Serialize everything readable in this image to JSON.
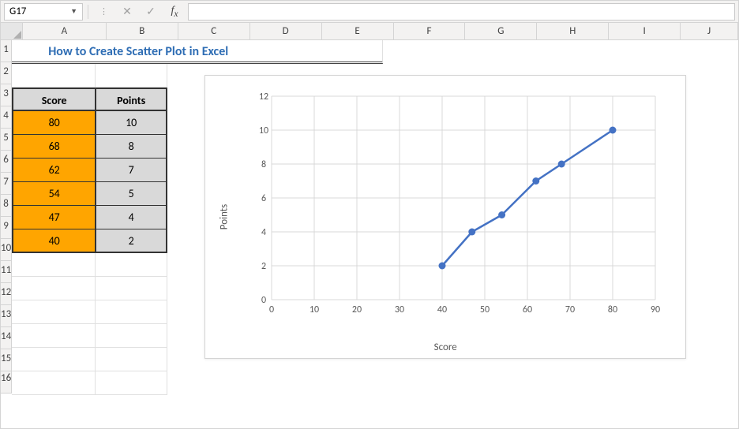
{
  "formula_bar": {
    "name_box": "G17",
    "formula": ""
  },
  "columns": [
    "A",
    "B",
    "C",
    "D",
    "E",
    "F",
    "G",
    "H",
    "I",
    "J"
  ],
  "rows": [
    "1",
    "2",
    "3",
    "4",
    "5",
    "6",
    "7",
    "8",
    "9",
    "10",
    "11",
    "12",
    "13",
    "14",
    "15",
    "16"
  ],
  "title": "How to Create Scatter Plot in Excel",
  "table": {
    "headers": {
      "score": "Score",
      "points": "Points"
    },
    "rows": [
      {
        "score": "80",
        "points": "10"
      },
      {
        "score": "68",
        "points": "8"
      },
      {
        "score": "62",
        "points": "7"
      },
      {
        "score": "54",
        "points": "5"
      },
      {
        "score": "47",
        "points": "4"
      },
      {
        "score": "40",
        "points": "2"
      }
    ]
  },
  "chart_data": {
    "type": "scatter",
    "xlabel": "Score",
    "ylabel": "Points",
    "xlim": [
      0,
      90
    ],
    "ylim": [
      0,
      12
    ],
    "xticks": [
      0,
      10,
      20,
      30,
      40,
      50,
      60,
      70,
      80,
      90
    ],
    "yticks": [
      0,
      2,
      4,
      6,
      8,
      10,
      12
    ],
    "series": [
      {
        "name": "Points",
        "x": [
          40,
          47,
          54,
          62,
          68,
          80
        ],
        "y": [
          2,
          4,
          5,
          7,
          8,
          10
        ]
      }
    ]
  }
}
